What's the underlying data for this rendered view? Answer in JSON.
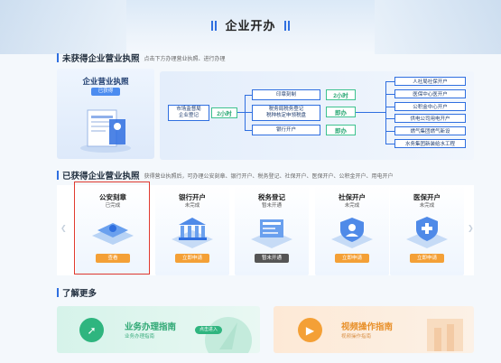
{
  "header": {
    "title": "企业开办"
  },
  "section1": {
    "title": "未获得企业营业执照",
    "subtitle": "点击下方办理营业执照、进行办理"
  },
  "license": {
    "title": "企业营业执照",
    "badge": "已获得"
  },
  "flow": {
    "start": "市场监督局\n企业登记",
    "start_time": "2小时",
    "mid": [
      {
        "label": "印章刻制",
        "tag": "2小时"
      },
      {
        "label": "税务局税务登记\n税种核定申领税盘",
        "tag": "即办"
      },
      {
        "label": "银行开户",
        "tag": "即办"
      }
    ],
    "right": [
      "人社局社保开户",
      "医保中心医开户",
      "公积金中心开户",
      "供电公司用电开户",
      "燃气集团燃气新设",
      "水务集团新装给水工程"
    ]
  },
  "section2": {
    "title": "已获得企业营业执照",
    "subtitle": "获得营业执照后，可办理公安刻章、银行开户、税务登记、社保开户、医保开户、公积金开户、用电开户"
  },
  "services": [
    {
      "title": "公安刻章",
      "status": "已完成",
      "button": "查看",
      "button_style": "orange"
    },
    {
      "title": "银行开户",
      "status": "未完成",
      "button": "立即申请",
      "button_style": "orange"
    },
    {
      "title": "税务登记",
      "status": "暂未开通",
      "button": "暂未开通",
      "button_style": "gray"
    },
    {
      "title": "社保开户",
      "status": "未完成",
      "button": "立即申请",
      "button_style": "orange"
    },
    {
      "title": "医保开户",
      "status": "未完成",
      "button": "立即申请",
      "button_style": "orange"
    }
  ],
  "section3": {
    "title": "了解更多"
  },
  "more": [
    {
      "title": "业务办理指南",
      "subtitle": "业务办理指南",
      "button": "点击进入",
      "icon": "compass-icon",
      "color": "#2fb57f"
    },
    {
      "title": "视频操作指南",
      "subtitle": "视频操作指南",
      "icon": "video-icon",
      "color": "#f4a036"
    }
  ]
}
